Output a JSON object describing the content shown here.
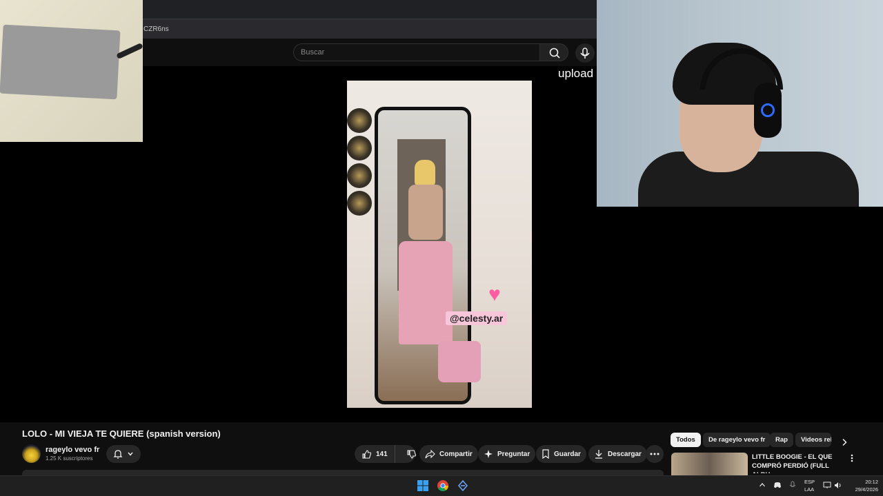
{
  "browser": {
    "url_fragment": "CZR6ns"
  },
  "header": {
    "search_placeholder": "Buscar",
    "icons": [
      "search-icon",
      "mic-icon"
    ]
  },
  "player": {
    "overlay_text": "upload",
    "sticker_text": "@celesty.ar"
  },
  "video": {
    "title": "LOLO - MI VIEJA TE QUIERE (spanish version)",
    "channel": {
      "name": "rageylo vevo fr",
      "subscribers": "1.25 K suscriptores"
    },
    "actions": {
      "likes": "141",
      "share": "Compartir",
      "ask": "Preguntar",
      "save": "Guardar",
      "download": "Descargar"
    }
  },
  "sidebar": {
    "chips": [
      {
        "label": "Todos",
        "active": true
      },
      {
        "label": "De rageylo vevo fr",
        "active": false
      },
      {
        "label": "Rap",
        "active": false
      },
      {
        "label": "Videos rel",
        "active": false
      }
    ],
    "recommendation": {
      "title": "LITTLE BOOGIE - EL QUE COMPRÓ PERDIÓ (FULL ALBU..."
    }
  },
  "taskbar": {
    "lang_line1": "ESP",
    "lang_line2": "LAA",
    "time": "20:12",
    "date": "29/4/2026"
  },
  "colors": {
    "yt_background": "#0f0f0f",
    "chip_active": "#f1f1f1",
    "button_bg": "#272727",
    "sticker_pink": "#f7c6d8",
    "heart": "#ff5da2"
  }
}
